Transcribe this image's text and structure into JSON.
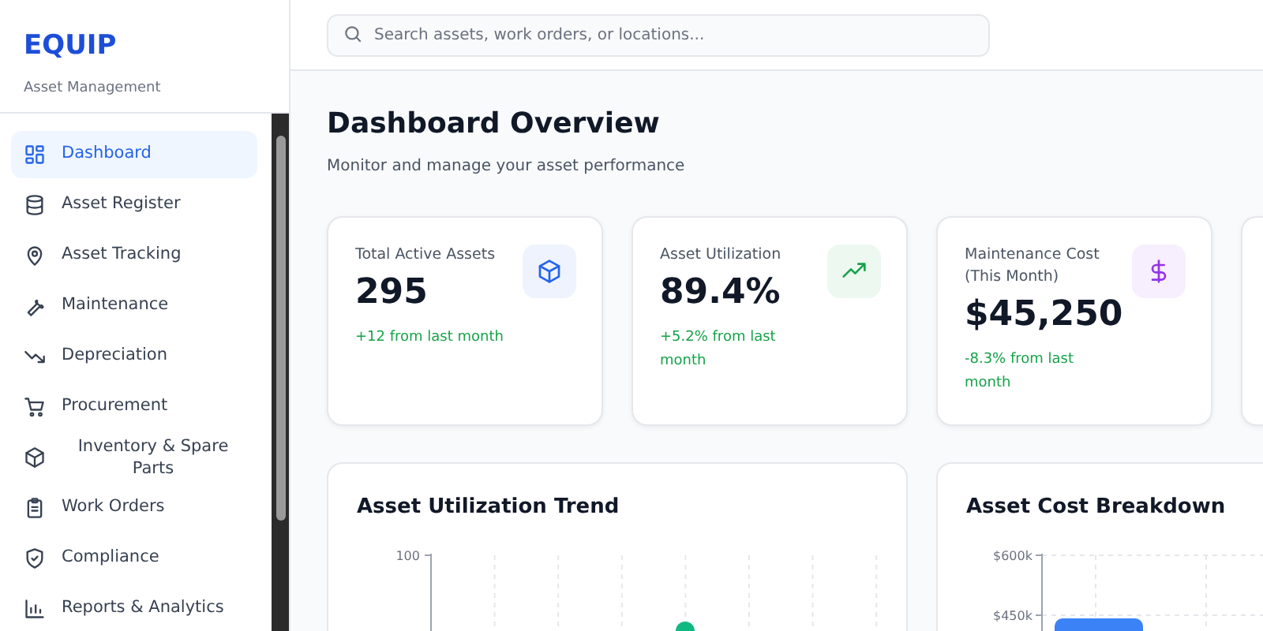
{
  "brand": {
    "name": "EQUIP",
    "tagline": "Asset Management"
  },
  "sidebar": {
    "items": [
      {
        "label": "Dashboard",
        "selected": true
      },
      {
        "label": "Asset Register",
        "selected": false
      },
      {
        "label": "Asset Tracking",
        "selected": false
      },
      {
        "label": "Maintenance",
        "selected": false
      },
      {
        "label": "Depreciation",
        "selected": false
      },
      {
        "label": "Procurement",
        "selected": false
      },
      {
        "label": "Inventory & Spare Parts",
        "selected": false
      },
      {
        "label": "Work Orders",
        "selected": false
      },
      {
        "label": "Compliance",
        "selected": false
      },
      {
        "label": "Reports & Analytics",
        "selected": false
      }
    ]
  },
  "search": {
    "placeholder": "Search assets, work orders, or locations..."
  },
  "header": {
    "title": "Dashboard Overview",
    "subtitle": "Monitor and manage your asset performance"
  },
  "stats": [
    {
      "kind": "metric",
      "label": "Total Active Assets",
      "value": "295",
      "change": "+12 from last month",
      "color": "#2563eb"
    },
    {
      "kind": "metric",
      "label": "Asset Utilization",
      "value": "89.4%",
      "change": "+5.2% from last month",
      "color": "#16a34a"
    },
    {
      "kind": "metric",
      "label": "Maintenance Cost (This Month)",
      "value": "$45,250",
      "change": "-8.3% from last month",
      "color": "#9333ea"
    },
    {
      "kind": "partial"
    }
  ],
  "charts": [
    {
      "title": "Asset Utilization Trend",
      "kind": "line",
      "y_tick_labels": [
        "100"
      ]
    },
    {
      "title": "Asset Cost Breakdown",
      "kind": "bar",
      "y_tick_labels": [
        "$600k",
        "$450k"
      ]
    }
  ]
}
